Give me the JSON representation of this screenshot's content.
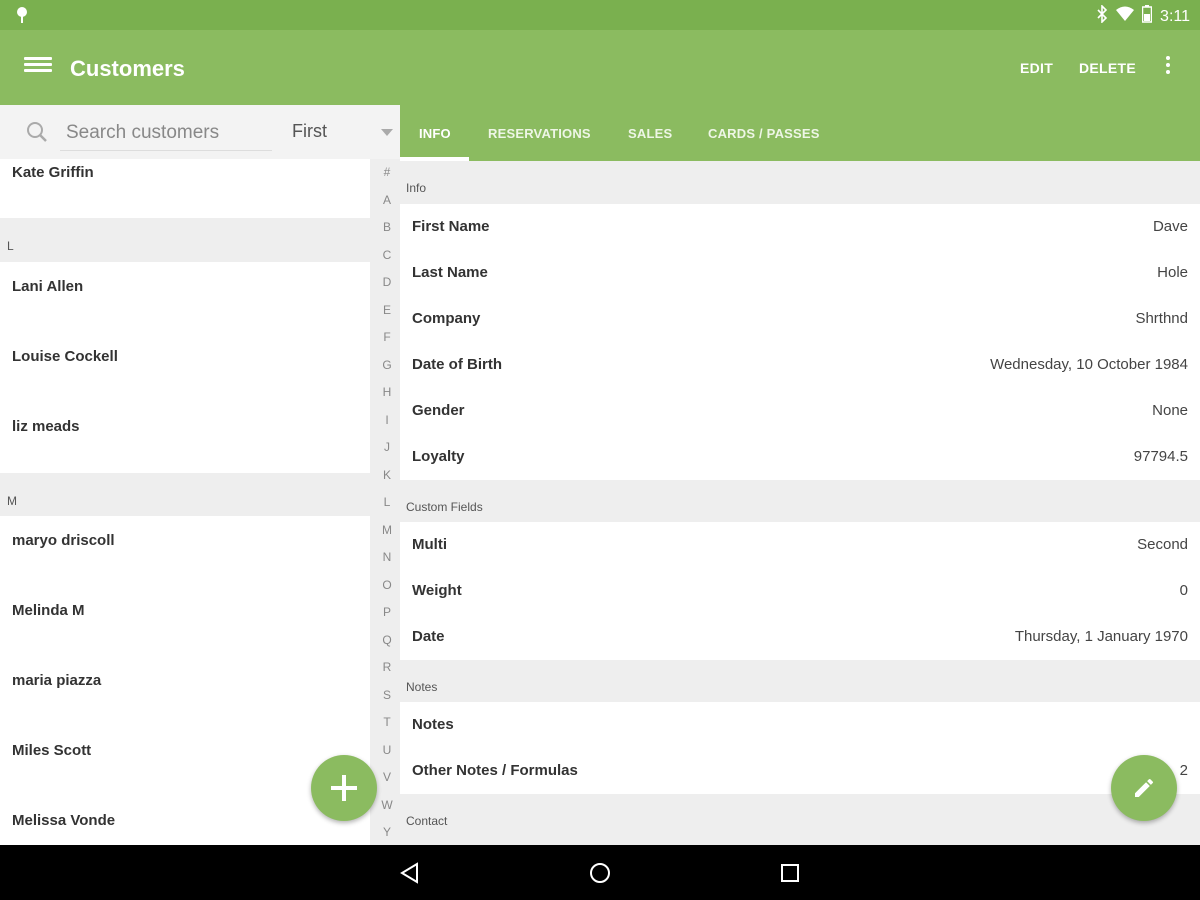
{
  "status_bar": {
    "time": "3:11"
  },
  "app_bar": {
    "title": "Customers",
    "edit_label": "EDIT",
    "delete_label": "DELETE"
  },
  "search": {
    "placeholder": "Search customers",
    "sort_value": "First"
  },
  "customer_list": {
    "partial_top": "Kate Griffin",
    "sections": [
      {
        "letter": "L",
        "names": [
          "Lani Allen",
          "Louise Cockell",
          "liz meads"
        ]
      },
      {
        "letter": "M",
        "names": [
          "maryo driscoll",
          "Melinda M",
          "maria piazza",
          "Miles Scott",
          "Melissa Vonde"
        ]
      }
    ]
  },
  "alphabet_index": [
    "#",
    "A",
    "B",
    "C",
    "D",
    "E",
    "F",
    "G",
    "H",
    "I",
    "J",
    "K",
    "L",
    "M",
    "N",
    "O",
    "P",
    "Q",
    "R",
    "S",
    "T",
    "U",
    "V",
    "W",
    "Y"
  ],
  "tabs": [
    "INFO",
    "RESERVATIONS",
    "SALES",
    "CARDS / PASSES"
  ],
  "active_tab": "INFO",
  "detail": {
    "info": {
      "header": "Info",
      "fields": [
        {
          "label": "First Name",
          "value": "Dave"
        },
        {
          "label": "Last Name",
          "value": "Hole"
        },
        {
          "label": "Company",
          "value": "Shrthnd"
        },
        {
          "label": "Date of Birth",
          "value": "Wednesday, 10 October 1984"
        },
        {
          "label": "Gender",
          "value": "None"
        },
        {
          "label": "Loyalty",
          "value": "97794.5"
        }
      ]
    },
    "custom": {
      "header": "Custom Fields",
      "fields": [
        {
          "label": "Multi",
          "value": "Second"
        },
        {
          "label": "Weight",
          "value": "0"
        },
        {
          "label": "Date",
          "value": "Thursday, 1 January 1970"
        }
      ]
    },
    "notes": {
      "header": "Notes",
      "fields": [
        {
          "label": "Notes",
          "value": ""
        },
        {
          "label": "Other Notes / Formulas",
          "value": "2"
        }
      ]
    },
    "contact": {
      "header": "Contact"
    }
  },
  "colors": {
    "status_bar": "#7ab04f",
    "primary": "#8bbb60",
    "background": "#eeeeee",
    "nav_bar": "#000000"
  },
  "icons": [
    "location-pin-icon",
    "bluetooth-icon",
    "wifi-icon",
    "battery-icon",
    "menu-icon",
    "more-vert-icon",
    "search-icon",
    "dropdown-caret-icon",
    "plus-icon",
    "pencil-icon",
    "back-icon",
    "home-icon",
    "recents-icon"
  ]
}
